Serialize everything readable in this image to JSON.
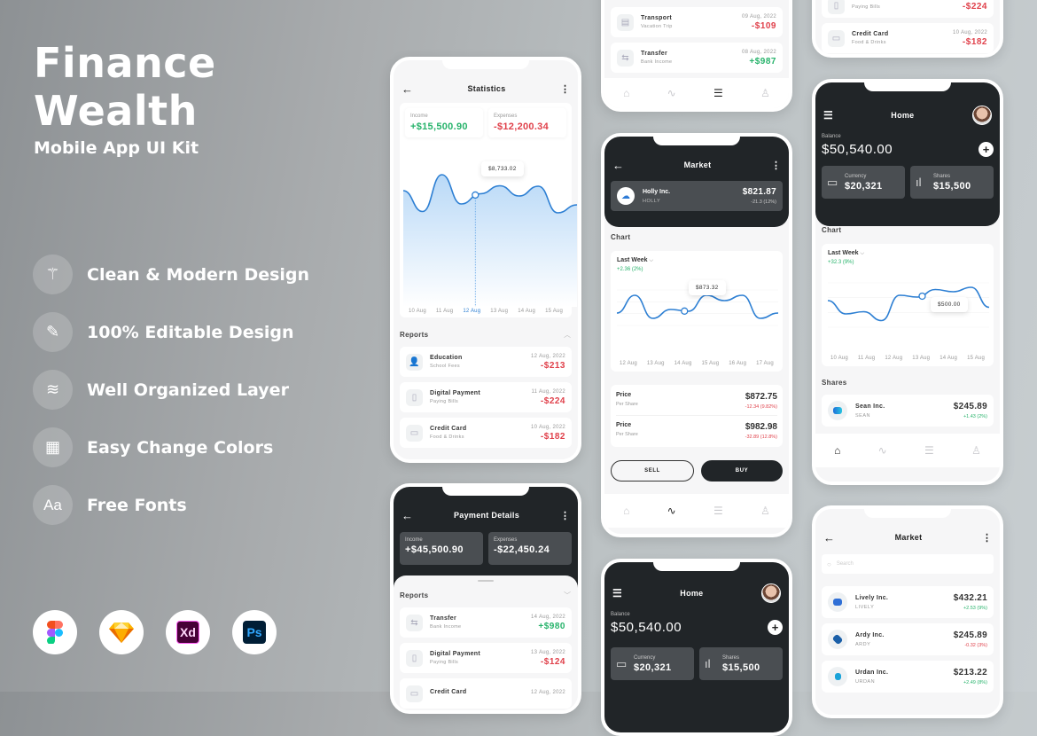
{
  "hero": {
    "title_line1": "Finance",
    "title_line2": "Wealth",
    "subtitle": "Mobile App UI Kit"
  },
  "features": [
    {
      "icon": "magic-wand-icon",
      "glyph": "⚚",
      "label": "Clean & Modern Design"
    },
    {
      "icon": "pen-tool-icon",
      "glyph": "✎",
      "label": "100% Editable Design"
    },
    {
      "icon": "layers-icon",
      "glyph": "≋",
      "label": "Well Organized Layer"
    },
    {
      "icon": "color-swatch-icon",
      "glyph": "▦",
      "label": "Easy Change Colors"
    },
    {
      "icon": "font-icon",
      "glyph": "Aa",
      "label": "Free Fonts"
    }
  ],
  "tools": [
    {
      "icon": "figma-icon",
      "label": "Figma"
    },
    {
      "icon": "sketch-icon",
      "label": "Sketch"
    },
    {
      "icon": "adobe-xd-icon",
      "label": "Xd"
    },
    {
      "icon": "photoshop-icon",
      "label": "Ps"
    }
  ],
  "statistics": {
    "title": "Statistics",
    "income_label": "Income",
    "income_value": "+$15,500.90",
    "expenses_label": "Expenses",
    "expenses_value": "-$12,200.34",
    "tooltip": "$8,733.02",
    "selected_date": "12 Aug",
    "reports_label": "Reports",
    "reports": [
      {
        "icon": "education-icon",
        "title": "Education",
        "sub": "School Fees",
        "date": "12 Aug, 2022",
        "amount": "-$213",
        "type": "neg"
      },
      {
        "icon": "digital-payment-icon",
        "title": "Digital Payment",
        "sub": "Paying Bills",
        "date": "11 Aug, 2022",
        "amount": "-$224",
        "type": "neg"
      },
      {
        "icon": "credit-card-icon",
        "title": "Credit Card",
        "sub": "Food & Drinks",
        "date": "10 Aug, 2022",
        "amount": "-$182",
        "type": "neg"
      }
    ]
  },
  "payment_details": {
    "title": "Payment Details",
    "income_label": "Income",
    "income_value": "+$45,500.90",
    "expenses_label": "Expenses",
    "expenses_value": "-$22,450.24",
    "reports_label": "Reports",
    "reports": [
      {
        "title": "Transfer",
        "sub": "Bank Income",
        "date": "14 Aug, 2022",
        "amount": "+$980",
        "type": "pos"
      },
      {
        "title": "Digital Payment",
        "sub": "Paying Bills",
        "date": "13 Aug, 2022",
        "amount": "-$124",
        "type": "neg"
      },
      {
        "title": "Credit Card",
        "sub": "",
        "date": "12 Aug, 2022",
        "amount": "",
        "type": "neg"
      }
    ]
  },
  "top_list": {
    "reports": [
      {
        "title": "Transport",
        "sub": "Vacation Trip",
        "date": "09 Aug, 2022",
        "amount": "-$109",
        "type": "neg"
      },
      {
        "title": "Transfer",
        "sub": "Bank Income",
        "date": "08 Aug, 2022",
        "amount": "+$987",
        "type": "pos"
      }
    ]
  },
  "market_detail": {
    "title": "Market",
    "company": "Holly Inc.",
    "ticker": "HOLLY",
    "price": "$821.87",
    "change": "-21.3 (12%)",
    "chart_label": "Chart",
    "period": "Last Week",
    "period_change": "+2.36 (2%)",
    "tooltip": "$873.32",
    "prices": [
      {
        "label": "Price",
        "sub": "Per Share",
        "value": "$872.75",
        "change": "-12.34 (9.82%)"
      },
      {
        "label": "Price",
        "sub": "Per Share",
        "value": "$982.98",
        "change": "-32.89 (12.8%)"
      }
    ],
    "sell_label": "SELL",
    "buy_label": "BUY"
  },
  "home_top": {
    "title": "Home",
    "balance_label": "Balance",
    "balance": "$50,540.00",
    "currency_label": "Currency",
    "currency_value": "$20,321",
    "shares_label": "Shares",
    "shares_value": "$15,500",
    "chart_label": "Chart",
    "period": "Last Week",
    "period_change": "+32.3 (9%)",
    "tooltip": "$500.00",
    "shares_section": "Shares",
    "share": {
      "company": "Sean Inc.",
      "ticker": "SEAN",
      "price": "$245.89",
      "change": "+1.43 (2%)"
    }
  },
  "top_right_list": {
    "reports": [
      {
        "title": "",
        "sub": "Paying Bills",
        "date": "",
        "amount": "-$224",
        "type": "neg"
      },
      {
        "title": "Credit Card",
        "sub": "Food & Drinks",
        "date": "10 Aug, 2022",
        "amount": "-$182",
        "type": "neg"
      }
    ]
  },
  "home_bottom": {
    "title": "Home",
    "balance_label": "Balance",
    "balance": "$50,540.00",
    "currency_label": "Currency",
    "currency_value": "$20,321",
    "shares_label": "Shares",
    "shares_value": "$15,500"
  },
  "market_list": {
    "title": "Market",
    "search_placeholder": "Search",
    "stocks": [
      {
        "company": "Lively Inc.",
        "ticker": "LIVELY",
        "price": "$432.21",
        "change": "+2.53 (9%)",
        "type": "pos",
        "color": "#2f6fd6"
      },
      {
        "company": "Ardy Inc.",
        "ticker": "ARDY",
        "price": "$245.89",
        "change": "-0.32 (3%)",
        "type": "neg",
        "color": "#1a5fa8"
      },
      {
        "company": "Urdan Inc.",
        "ticker": "URDAN",
        "price": "$213.22",
        "change": "+2.49 (8%)",
        "type": "pos",
        "color": "#1aa3d9"
      }
    ]
  },
  "nav": [
    {
      "icon": "home-icon",
      "glyph": "⌂"
    },
    {
      "icon": "activity-icon",
      "glyph": "∿"
    },
    {
      "icon": "list-icon",
      "glyph": "☰"
    },
    {
      "icon": "profile-icon",
      "glyph": "♙"
    }
  ],
  "chart_data": [
    {
      "type": "area",
      "title": "Statistics",
      "x": [
        "10 Aug",
        "11 Aug",
        "12 Aug",
        "13 Aug",
        "14 Aug",
        "15 Aug"
      ],
      "series": [
        {
          "name": "Balance",
          "values": [
            0.62,
            0.15,
            0.98,
            0.32,
            0.55,
            0.73,
            0.5,
            0.72,
            0.12,
            0.3
          ]
        }
      ],
      "highlight": {
        "x": "12 Aug",
        "label": "$8,733.02"
      }
    },
    {
      "type": "line",
      "title": "Last Week",
      "x": [
        "12 Aug",
        "13 Aug",
        "14 Aug",
        "15 Aug",
        "16 Aug",
        "17 Aug"
      ],
      "series": [
        {
          "name": "Holly Inc.",
          "values": [
            0.35,
            0.85,
            0.2,
            0.45,
            0.4,
            0.85,
            0.7,
            0.85,
            0.2,
            0.35
          ]
        }
      ],
      "highlight": {
        "x": "14 Aug",
        "label": "$873.32"
      }
    },
    {
      "type": "line",
      "title": "Last Week",
      "x": [
        "10 Aug",
        "11 Aug",
        "12 Aug",
        "13 Aug",
        "14 Aug",
        "15 Aug"
      ],
      "series": [
        {
          "name": "Balance",
          "values": [
            0.6,
            0.3,
            0.35,
            0.15,
            0.72,
            0.68,
            0.85,
            0.8,
            0.9,
            0.45
          ]
        }
      ],
      "highlight": {
        "x": "13 Aug",
        "label": "$500.00"
      }
    }
  ]
}
